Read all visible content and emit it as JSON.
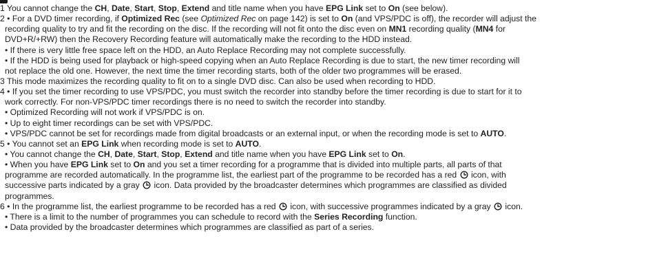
{
  "lines": [
    {
      "indent": false,
      "segments": [
        {
          "t": "1 You cannot change the "
        },
        {
          "t": "CH",
          "s": "b"
        },
        {
          "t": ", "
        },
        {
          "t": "Date",
          "s": "b"
        },
        {
          "t": ", "
        },
        {
          "t": "Start",
          "s": "b"
        },
        {
          "t": ", "
        },
        {
          "t": "Stop",
          "s": "b"
        },
        {
          "t": ", "
        },
        {
          "t": "Extend",
          "s": "b"
        },
        {
          "t": " and title name when you have "
        },
        {
          "t": "EPG Link",
          "s": "b"
        },
        {
          "t": " set to "
        },
        {
          "t": "On",
          "s": "b"
        },
        {
          "t": " (see below)."
        }
      ]
    },
    {
      "indent": false,
      "segments": [
        {
          "t": "2 • For a DVD timer recording, if "
        },
        {
          "t": "Optimized Rec",
          "s": "b"
        },
        {
          "t": " (see "
        },
        {
          "t": "Optimized Rec",
          "s": "i"
        },
        {
          "t": " on page 142) is set to "
        },
        {
          "t": "On",
          "s": "b"
        },
        {
          "t": " (and VPS/PDC is off), the recorder will adjust the"
        }
      ]
    },
    {
      "indent": true,
      "segments": [
        {
          "t": "recording quality to try and fit the recording on the disc. If the recording will not fit onto the disc even on "
        },
        {
          "t": "MN1",
          "s": "b"
        },
        {
          "t": " recording quality ("
        },
        {
          "t": "MN4",
          "s": "b"
        },
        {
          "t": " for"
        }
      ]
    },
    {
      "indent": true,
      "segments": [
        {
          "t": "DVD+R/+RW) then the Recovery Recording feature will automatically make the recording to the HDD instead."
        }
      ]
    },
    {
      "indent": true,
      "segments": [
        {
          "t": "• If there is very little free space left on the HDD, an Auto Replace Recording may not complete successfully."
        }
      ]
    },
    {
      "indent": true,
      "segments": [
        {
          "t": "• If the HDD is being used for playback or high-speed copying when an Auto Replace Recording is due to start, the new timer recording will"
        }
      ]
    },
    {
      "indent": true,
      "segments": [
        {
          "t": "not replace the old one. However, the next time the timer recording starts, both of the older two programmes will be erased."
        }
      ]
    },
    {
      "indent": false,
      "segments": [
        {
          "t": "3 This mode maximizes the recording quality to fit on to a single DVD disc. Can also be used when recording to HDD."
        }
      ]
    },
    {
      "indent": false,
      "segments": [
        {
          "t": "4 • If you set the timer recording to use VPS/PDC, you must switch the recorder into standby before the timer recording is due to start for it to"
        }
      ]
    },
    {
      "indent": true,
      "segments": [
        {
          "t": "work correctly. For non-VPS/PDC timer recordings there is no need to switch the recorder into standby."
        }
      ]
    },
    {
      "indent": true,
      "segments": [
        {
          "t": "• Optimized Recording will not work if VPS/PDC is on."
        }
      ]
    },
    {
      "indent": true,
      "segments": [
        {
          "t": "• Up to eight timer recordings can be set with VPS/PDC."
        }
      ]
    },
    {
      "indent": true,
      "segments": [
        {
          "t": "• VPS/PDC cannot be set for recordings made from digital broadcasts or an external input, or when the recording mode is set to "
        },
        {
          "t": "AUTO",
          "s": "b"
        },
        {
          "t": "."
        }
      ]
    },
    {
      "indent": false,
      "segments": [
        {
          "t": "5 • You cannot set an "
        },
        {
          "t": "EPG Link",
          "s": "b"
        },
        {
          "t": " when recording mode is set to "
        },
        {
          "t": "AUTO",
          "s": "b"
        },
        {
          "t": "."
        }
      ]
    },
    {
      "indent": true,
      "segments": [
        {
          "t": "• You cannot change the "
        },
        {
          "t": "CH",
          "s": "b"
        },
        {
          "t": ", "
        },
        {
          "t": "Date",
          "s": "b"
        },
        {
          "t": ", "
        },
        {
          "t": "Start",
          "s": "b"
        },
        {
          "t": ", "
        },
        {
          "t": "Stop",
          "s": "b"
        },
        {
          "t": ", "
        },
        {
          "t": "Extend",
          "s": "b"
        },
        {
          "t": " and title name when you have "
        },
        {
          "t": "EPG Link",
          "s": "b"
        },
        {
          "t": " set to "
        },
        {
          "t": "On",
          "s": "b"
        },
        {
          "t": "."
        }
      ]
    },
    {
      "indent": true,
      "segments": [
        {
          "t": "• When you have "
        },
        {
          "t": "EPG Link",
          "s": "b"
        },
        {
          "t": " set to "
        },
        {
          "t": "On",
          "s": "b"
        },
        {
          "t": " and you set a timer recording for a programme that is divided into multiple parts, all parts of that"
        }
      ]
    },
    {
      "indent": true,
      "segments": [
        {
          "t": "programme are recorded automatically. In the programme list, the earliest part of the programme to be recorded has a red "
        },
        {
          "t": "clock-icon",
          "s": "icon"
        },
        {
          "t": " icon, with"
        }
      ]
    },
    {
      "indent": true,
      "segments": [
        {
          "t": "successive parts indicated by a gray "
        },
        {
          "t": "clock-icon",
          "s": "icon"
        },
        {
          "t": " icon. Data provided by the broadcaster determines which programmes are classified as divided"
        }
      ]
    },
    {
      "indent": true,
      "segments": [
        {
          "t": "programmes."
        }
      ]
    },
    {
      "indent": false,
      "segments": [
        {
          "t": "6 • In the programme list, the earliest programme to be recorded has a red "
        },
        {
          "t": "clock-icon",
          "s": "icon"
        },
        {
          "t": " icon, with successive programmes indicated by a gray "
        },
        {
          "t": "clock-icon",
          "s": "icon"
        },
        {
          "t": " icon."
        }
      ]
    },
    {
      "indent": true,
      "segments": [
        {
          "t": "• There is a limit to the number of programmes you can schedule to record with the "
        },
        {
          "t": "Series Recording",
          "s": "b"
        },
        {
          "t": " function."
        }
      ]
    },
    {
      "indent": true,
      "segments": [
        {
          "t": "• Data provided by the broadcaster determines which programmes are classified as part of a series."
        }
      ]
    }
  ]
}
